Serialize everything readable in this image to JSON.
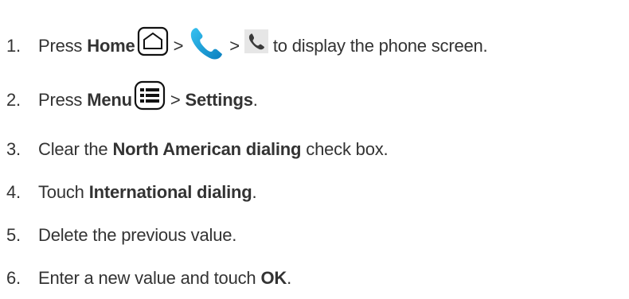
{
  "steps": [
    {
      "number": "1.",
      "parts": {
        "t1": "Press",
        "b1": "Home",
        "gt1": ">",
        "gt2": ">",
        "t2": "to display the phone screen."
      }
    },
    {
      "number": "2.",
      "parts": {
        "t1": "Press",
        "b1": "Menu",
        "gt1": ">",
        "b2": "Settings",
        "t2": "."
      }
    },
    {
      "number": "3.",
      "parts": {
        "t1": "Clear the",
        "b1": "North American dialing",
        "t2": "check box."
      }
    },
    {
      "number": "4.",
      "parts": {
        "t1": "Touch",
        "b1": "International dialing",
        "t2": "."
      }
    },
    {
      "number": "5.",
      "parts": {
        "t1": "Delete the previous value."
      }
    },
    {
      "number": "6.",
      "parts": {
        "t1": "Enter a new value and touch",
        "b1": "OK",
        "t2": "."
      }
    }
  ],
  "icons": {
    "home": "home-icon",
    "phone_app": "phone-icon",
    "phone_tab": "phone-icon",
    "menu": "menu-icon"
  },
  "colors": {
    "text": "#333333",
    "phone_blue": "#1aa3d9",
    "phone_tab_bg": "#e6e6e6",
    "phone_tab_fg": "#3a3a3a",
    "icon_outline": "#111111"
  }
}
